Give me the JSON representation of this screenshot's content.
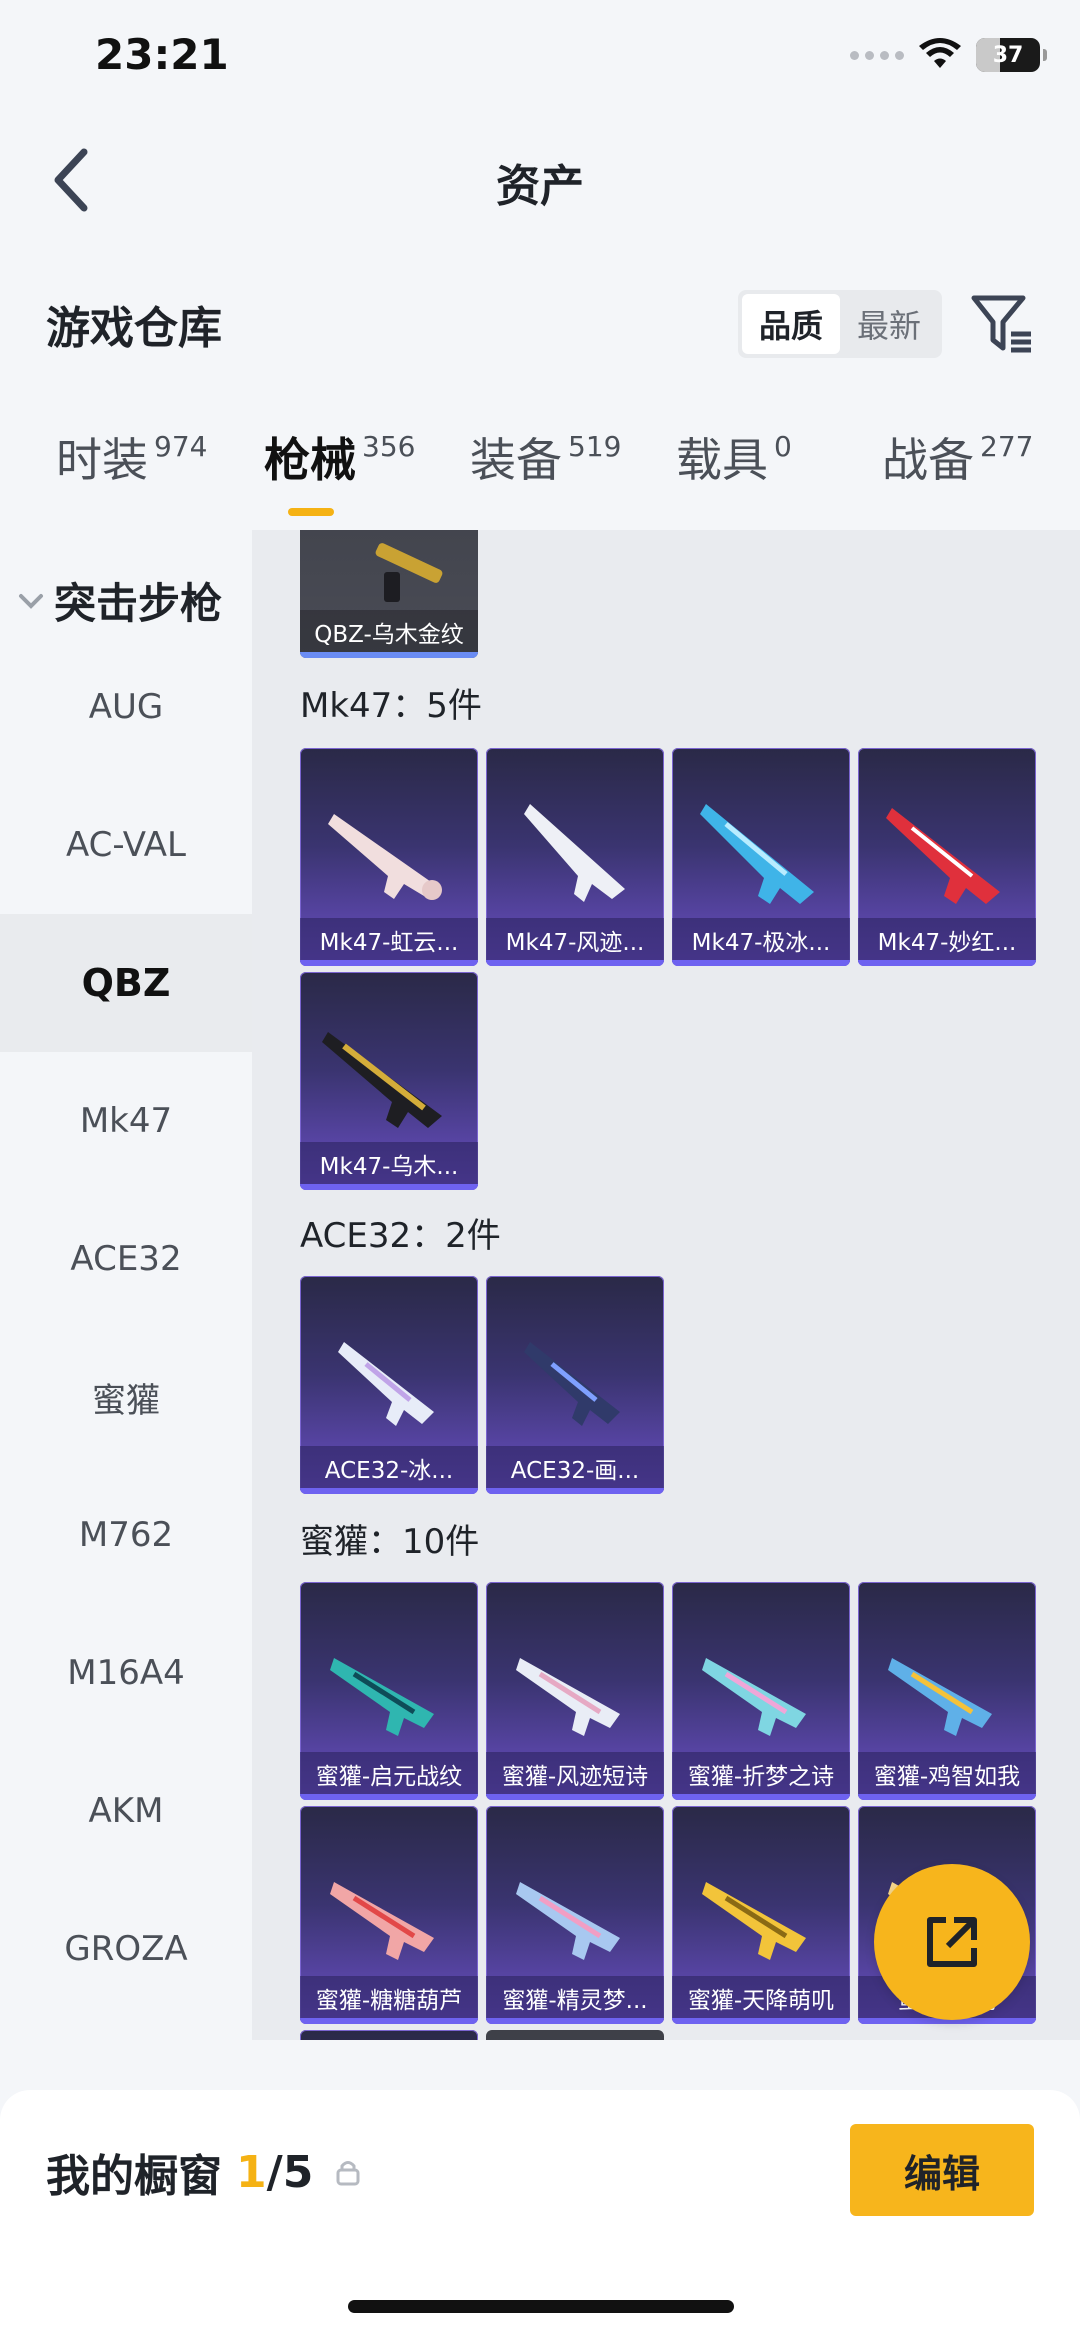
{
  "status_bar": {
    "time": "23:21",
    "battery": "37",
    "battery_level": 0.37
  },
  "nav": {
    "title": "资产"
  },
  "section": {
    "title": "游戏仓库",
    "sort_options": [
      "品质",
      "最新"
    ],
    "sort_selected": "品质"
  },
  "tabs": [
    {
      "label": "时装",
      "count": "974"
    },
    {
      "label": "枪械",
      "count": "356",
      "active": true
    },
    {
      "label": "装备",
      "count": "519"
    },
    {
      "label": "载具",
      "count": "0"
    },
    {
      "label": "战备",
      "count": "277"
    }
  ],
  "sidebar": {
    "category": "突击步枪",
    "items": [
      "AUG",
      "AC-VAL",
      "QBZ",
      "Mk47",
      "ACE32",
      "蜜獾",
      "M762",
      "M16A4",
      "AKM",
      "GROZA"
    ],
    "active": "QBZ"
  },
  "content": {
    "top_card": "QBZ-乌木金纹",
    "groups": [
      {
        "title": "Mk47：5件",
        "items": [
          "Mk47-虹云...",
          "Mk47-风迹...",
          "Mk47-极冰...",
          "Mk47-妙红...",
          "Mk47-乌木..."
        ]
      },
      {
        "title": "ACE32：2件",
        "items": [
          "ACE32-冰...",
          "ACE32-画..."
        ]
      },
      {
        "title": "蜜獾：10件",
        "items": [
          "蜜獾-启元战纹",
          "蜜獾-风迹短诗",
          "蜜獾-折梦之诗",
          "蜜獾-鸡智如我",
          "蜜獾-糖糖葫芦",
          "蜜獾-精灵梦...",
          "蜜獾-天降萌叽",
          "蜜獾-...鸡"
        ]
      }
    ]
  },
  "bottom": {
    "title": "我的橱窗",
    "count": "1",
    "total": "/5",
    "edit_label": "编辑"
  },
  "colors": {
    "accent": "#f5b214",
    "card_purple": "#6a4fc5"
  }
}
